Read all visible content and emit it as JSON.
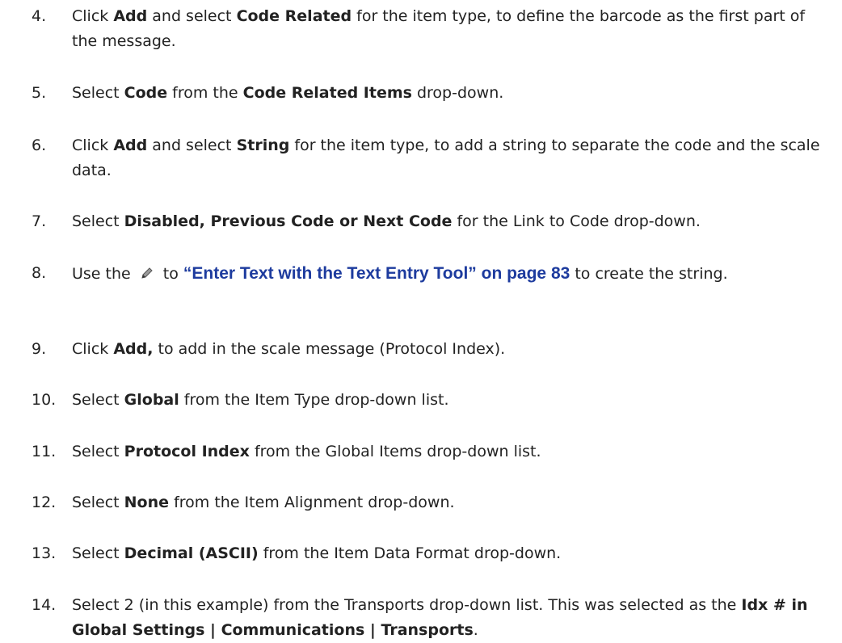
{
  "steps": [
    {
      "number": "4.",
      "parts": [
        {
          "t": "Click "
        },
        {
          "t": "Add",
          "b": true
        },
        {
          "t": " and select "
        },
        {
          "t": "Code Related",
          "b": true
        },
        {
          "t": " for the item type, to define the barcode as the first part of the message."
        }
      ]
    },
    {
      "number": "5.",
      "parts": [
        {
          "t": "Select "
        },
        {
          "t": "Code",
          "b": true
        },
        {
          "t": " from the "
        },
        {
          "t": "Code Related Items",
          "b": true
        },
        {
          "t": " drop-down."
        }
      ]
    },
    {
      "number": "6.",
      "parts": [
        {
          "t": "Click "
        },
        {
          "t": "Add",
          "b": true
        },
        {
          "t": " and select "
        },
        {
          "t": "String",
          "b": true
        },
        {
          "t": " for the item type, to add a string to separate the code and the scale data."
        }
      ]
    },
    {
      "number": "7.",
      "parts": [
        {
          "t": "Select "
        },
        {
          "t": "Disabled, Previous Code or Next Code",
          "b": true
        },
        {
          "t": " for the Link to Code drop-down."
        }
      ]
    },
    {
      "number": "8.",
      "parts": [
        {
          "t": "Use the "
        },
        {
          "icon": "pencil-icon"
        },
        {
          "t": " to "
        },
        {
          "t": "“Enter Text with the Text Entry Tool” on page 83",
          "link": true
        },
        {
          "t": " to create the string."
        }
      ]
    },
    {
      "number": "9.",
      "parts": [
        {
          "t": "Click "
        },
        {
          "t": "Add,",
          "b": true
        },
        {
          "t": " to add in the scale message (Protocol Index)."
        }
      ]
    },
    {
      "number": "10.",
      "parts": [
        {
          "t": "Select "
        },
        {
          "t": "Global",
          "b": true
        },
        {
          "t": " from the Item Type drop-down list."
        }
      ]
    },
    {
      "number": "11.",
      "parts": [
        {
          "t": "Select "
        },
        {
          "t": "Protocol Index",
          "b": true
        },
        {
          "t": " from the Global Items drop-down list."
        }
      ]
    },
    {
      "number": "12.",
      "parts": [
        {
          "t": "Select "
        },
        {
          "t": "None",
          "b": true
        },
        {
          "t": " from the Item Alignment drop-down."
        }
      ]
    },
    {
      "number": "13.",
      "parts": [
        {
          "t": "Select "
        },
        {
          "t": "Decimal (ASCII)",
          "b": true
        },
        {
          "t": " from the Item Data Format drop-down."
        }
      ]
    },
    {
      "number": "14.",
      "parts": [
        {
          "t": "Select 2 (in this example) from the Transports drop-down list. This was selected as the "
        },
        {
          "t": "Idx # in Global Settings | Communications | Transports",
          "b": true
        },
        {
          "t": "."
        }
      ]
    }
  ]
}
